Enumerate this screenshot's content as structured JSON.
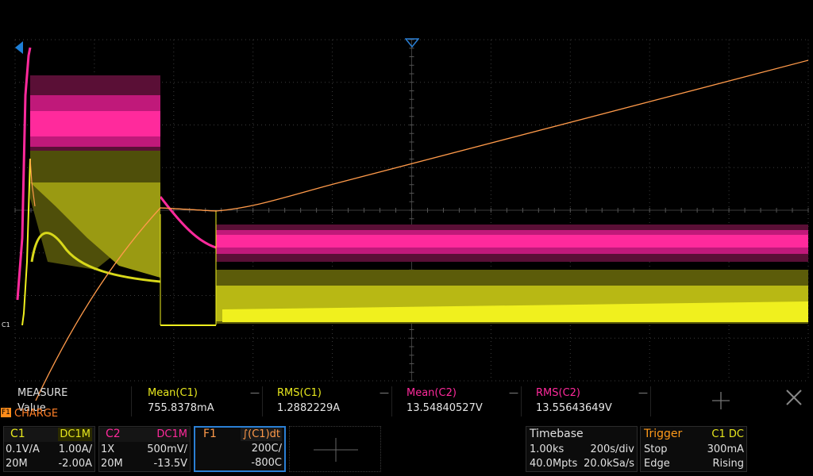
{
  "colors": {
    "c1": "#e8e81e",
    "c2": "#ff2a9c",
    "f1": "#ff9a4a",
    "trigger": "#2a7fd4",
    "grid": "#3c3c3c"
  },
  "screen": {
    "c1_ground_label": "C1",
    "trigger_position_icon": "triangle-down-icon",
    "level_marker_icon": "triangle-left-icon"
  },
  "measure": {
    "header_label": "MEASURE",
    "value_label": "Value",
    "columns": [
      {
        "name": "Mean(C1)",
        "value": "755.8378mA",
        "color": "#e8e81e"
      },
      {
        "name": "RMS(C1)",
        "value": "1.2882229A",
        "color": "#e8e81e"
      },
      {
        "name": "Mean(C2)",
        "value": "13.54840527V",
        "color": "#ff2a9c"
      },
      {
        "name": "RMS(C2)",
        "value": "13.55643649V",
        "color": "#ff2a9c"
      }
    ],
    "f1_tag": "F1",
    "f1_name": "CHARGE"
  },
  "channels": {
    "c1": {
      "label": "C1",
      "coupling": "DC1M",
      "probe": "0.1V/A",
      "scale": "1.00A/",
      "bw": "20M",
      "offset": "-2.00A"
    },
    "c2": {
      "label": "C2",
      "coupling": "DC1M",
      "probe": "1X",
      "scale": "500mV/",
      "bw": "20M",
      "offset": "-13.5V"
    },
    "f1": {
      "label": "F1",
      "function": "∫(C1)dt",
      "scale": "200C/",
      "offset": "-800C"
    }
  },
  "timebase": {
    "title": "Timebase",
    "delay": "1.00ks",
    "scale": "200s/div",
    "points": "40.0Mpts",
    "rate": "20.0kSa/s"
  },
  "trigger": {
    "title": "Trigger",
    "source": "C1 DC",
    "mode": "Stop",
    "level": "300mA",
    "type": "Edge",
    "slope": "Rising"
  }
}
